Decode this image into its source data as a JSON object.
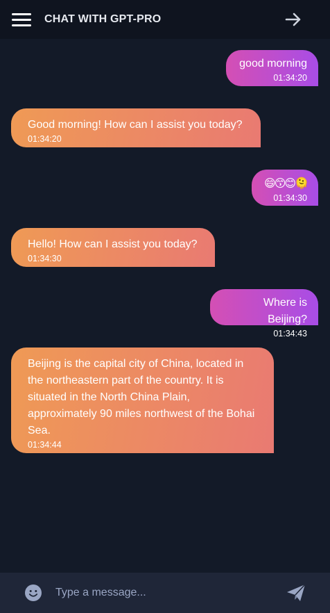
{
  "header": {
    "title": "CHAT WITH GPT-PRO"
  },
  "messages": [
    {
      "role": "user",
      "text": "good morning",
      "time": "01:34:20"
    },
    {
      "role": "assistant",
      "text": "Good morning! How can I assist you today?",
      "time": "01:34:20"
    },
    {
      "role": "user",
      "text": "😄😙😊🫠",
      "time": "01:34:30"
    },
    {
      "role": "assistant",
      "text": "Hello! How can I assist you today?",
      "time": "01:34:30"
    },
    {
      "role": "user",
      "text": "Where is Beijing?",
      "time": "01:34:43"
    },
    {
      "role": "assistant",
      "text": "Beijing is the capital city of China, located in the northeastern part of the country. It is situated in the North China Plain, approximately 90 miles northwest of the Bohai Sea.",
      "time": "01:34:44"
    }
  ],
  "composer": {
    "placeholder": "Type a message...",
    "value": ""
  },
  "icons": {
    "menu": "hamburger-icon",
    "forward": "arrow-right-icon",
    "emoji": "smiley-icon",
    "send": "paper-plane-icon"
  },
  "colors": {
    "background": "#131a28",
    "header": "#0f141f",
    "footer": "#1f2638",
    "user_bubble_start": "#d44fb4",
    "user_bubble_end": "#a84de6",
    "bot_bubble_start": "#ef9a55",
    "bot_bubble_end": "#e97a72"
  }
}
